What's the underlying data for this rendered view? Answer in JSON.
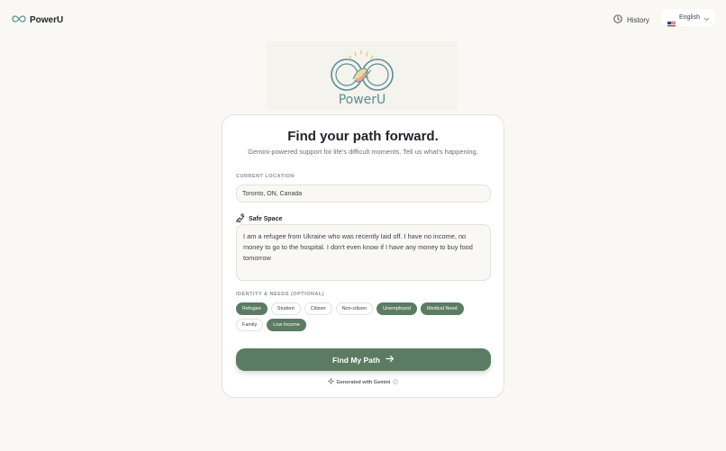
{
  "header": {
    "brand_name": "PowerU",
    "history_label": "History",
    "language_label": "English"
  },
  "logo": {
    "text": "PowerU"
  },
  "card": {
    "title": "Find your path forward.",
    "subtitle": "Gemini-powered support for life's difficult moments. Tell us what's happening.",
    "location_label": "CURRENT LOCATION",
    "location_value": "Toronto, ON, Canada",
    "safe_space_label": "Safe Space",
    "message": "I am a refugee from Ukraine who was recently laid off. I have no income, no money to go to the hospital. I don't even know if I have any money to buy food tomorrow",
    "identity_label": "IDENTITY & NEEDS (OPTIONAL)",
    "chips": [
      {
        "label": "Refugee",
        "selected": true
      },
      {
        "label": "Student",
        "selected": false
      },
      {
        "label": "Citizen",
        "selected": false
      },
      {
        "label": "Non-citizen",
        "selected": false
      },
      {
        "label": "Unemployed",
        "selected": true
      },
      {
        "label": "Medical Need",
        "selected": true
      },
      {
        "label": "Family",
        "selected": false
      },
      {
        "label": "Low Income",
        "selected": true
      }
    ],
    "cta_label": "Find My Path",
    "generated_label": "Generated with Gemini"
  },
  "colors": {
    "accent": "#5b7c62",
    "logo_teal": "#5a8e93",
    "background": "#f9f8f4"
  }
}
